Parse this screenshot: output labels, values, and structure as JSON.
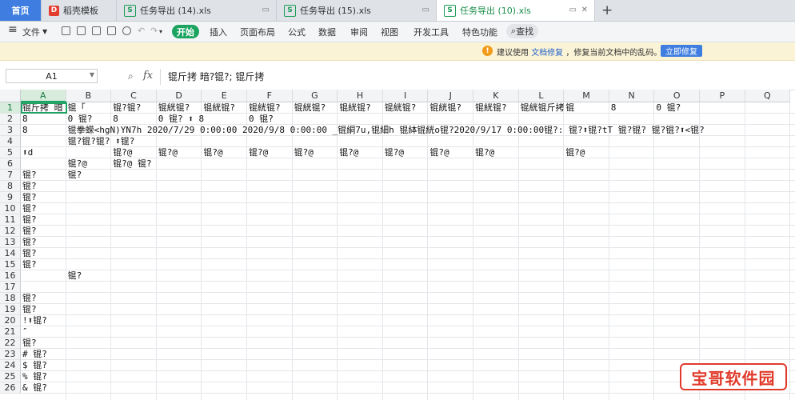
{
  "tabs": {
    "home": "首页",
    "items": [
      {
        "label": "稻壳模板",
        "icon": "D",
        "color": "#e23d2f"
      },
      {
        "label": "任务导出 (14).xls",
        "icon": "S",
        "color": "#1a9c55"
      },
      {
        "label": "任务导出 (15).xls",
        "icon": "S",
        "color": "#1a9c55"
      },
      {
        "label": "任务导出 (10).xls",
        "icon": "S",
        "color": "#1a9c55"
      }
    ],
    "plus": "+"
  },
  "menu": {
    "hamburger": "≡",
    "file": "文件",
    "start": "开始",
    "items": [
      "插入",
      "页面布局",
      "公式",
      "数据",
      "审阅",
      "视图",
      "开发工具",
      "特色功能"
    ],
    "search": "查找"
  },
  "notice": {
    "text_before": "建议使用",
    "link": "文档修复",
    "text_after": "，修复当前文档中的乱码。",
    "button": "立即修复"
  },
  "formula": {
    "cell_ref": "A1",
    "fx": "fx",
    "value": "锟斤拷  暗?锟?;  锟斤拷"
  },
  "grid": {
    "columns": [
      "A",
      "B",
      "C",
      "D",
      "E",
      "F",
      "G",
      "H",
      "I",
      "J",
      "K",
      "L",
      "M",
      "N",
      "O",
      "P",
      "Q"
    ],
    "rows": [
      "1",
      "2",
      "3",
      "4",
      "5",
      "6",
      "7",
      "8",
      "9",
      "10",
      "11",
      "12",
      "13",
      "14",
      "15",
      "16",
      "17",
      "18",
      "19",
      "20",
      "21",
      "22",
      "23",
      "24",
      "25",
      "26"
    ],
    "selected_col": "A",
    "selected_row": "1"
  },
  "cells": [
    {
      "r": 1,
      "c": 0,
      "t": "锟斤拷  暗"
    },
    {
      "r": 1,
      "c": 1,
      "t": "        锟「"
    },
    {
      "r": 1,
      "c": 2,
      "t": " 锟?锟? "
    },
    {
      "r": 1,
      "c": 3,
      "t": " 锟絖锟?"
    },
    {
      "r": 1,
      "c": 4,
      "t": " 锟絖锟?"
    },
    {
      "r": 1,
      "c": 5,
      "t": " 锟絖锟?"
    },
    {
      "r": 1,
      "c": 6,
      "t": " 锟絖锟?"
    },
    {
      "r": 1,
      "c": 7,
      "t": " 锟絖锟?"
    },
    {
      "r": 1,
      "c": 8,
      "t": " 锟絖锟?"
    },
    {
      "r": 1,
      "c": 9,
      "t": " 锟絖锟?"
    },
    {
      "r": 1,
      "c": 10,
      "t": " 锟絖锟?"
    },
    {
      "r": 1,
      "c": 11,
      "t": " 锟絖锟斤拷"
    },
    {
      "r": 1,
      "c": 12,
      "t": "  锟"
    },
    {
      "r": 1,
      "c": 13,
      "t": "    8"
    },
    {
      "r": 1,
      "c": 14,
      "t": "     0 锟?"
    },
    {
      "r": 2,
      "c": 0,
      "t": "  8"
    },
    {
      "r": 2,
      "c": 1,
      "t": "    0 锟?"
    },
    {
      "r": 2,
      "c": 2,
      "t": "  8"
    },
    {
      "r": 2,
      "c": 3,
      "t": "  0 锟? ⬆ 8"
    },
    {
      "r": 2,
      "c": 5,
      "t": "  0 锟?"
    },
    {
      "r": 3,
      "c": 0,
      "t": "  8"
    },
    {
      "r": 3,
      "c": 1,
      "t": "  锟拳蝾<hgN)YN7h 2020/7/29 0:00:00 2020/9/8 0:00:00   _锟絧7u,锟細h  锟絊锟絖o锟?2020/9/17 0:00:00锟?: 锟?⬆锟?tT 锟?锟?    锟?锟?⬆<锟?"
    },
    {
      "r": 4,
      "c": 1,
      "t": "      锟?锟?锟?  ⬆锟?"
    },
    {
      "r": 5,
      "c": 0,
      "t": "  ⬆d"
    },
    {
      "r": 5,
      "c": 2,
      "t": " 锟?@"
    },
    {
      "r": 5,
      "c": 3,
      "t": " 锟?@"
    },
    {
      "r": 5,
      "c": 4,
      "t": " 锟?@"
    },
    {
      "r": 5,
      "c": 5,
      "t": " 锟?@"
    },
    {
      "r": 5,
      "c": 6,
      "t": " 锟?@"
    },
    {
      "r": 5,
      "c": 7,
      "t": " 锟?@"
    },
    {
      "r": 5,
      "c": 8,
      "t": " 锟?@"
    },
    {
      "r": 5,
      "c": 9,
      "t": " 锟?@"
    },
    {
      "r": 5,
      "c": 10,
      "t": " 锟?@"
    },
    {
      "r": 5,
      "c": 12,
      "t": " 锟?@"
    },
    {
      "r": 6,
      "c": 1,
      "t": " 锟?@"
    },
    {
      "r": 6,
      "c": 2,
      "t": " 锟?@  锟?"
    },
    {
      "r": 7,
      "c": 0,
      "t": " 锟?"
    },
    {
      "r": 7,
      "c": 1,
      "t": "       锟?"
    },
    {
      "r": 8,
      "c": 0,
      "t": "   锟?"
    },
    {
      "r": 9,
      "c": 0,
      "t": "    锟?"
    },
    {
      "r": 10,
      "c": 0,
      "t": "    锟?"
    },
    {
      "r": 11,
      "c": 0,
      "t": "    锟?"
    },
    {
      "r": 12,
      "c": 0,
      "t": "    锟?"
    },
    {
      "r": 13,
      "c": 0,
      "t": "    锟?"
    },
    {
      "r": 14,
      "c": 0,
      "t": "   锟?"
    },
    {
      "r": 15,
      "c": 0,
      "t": "   锟?"
    },
    {
      "r": 16,
      "c": 1,
      "t": " 锟?"
    },
    {
      "r": 18,
      "c": 0,
      "t": "锟?"
    },
    {
      "r": 19,
      "c": 0,
      "t": "   锟?"
    },
    {
      "r": 20,
      "c": 0,
      "t": "   !⬆锟?"
    },
    {
      "r": 21,
      "c": 0,
      "t": "   ″"
    },
    {
      "r": 22,
      "c": 0,
      "t": "锟?"
    },
    {
      "r": 23,
      "c": 0,
      "t": "    # 锟?"
    },
    {
      "r": 24,
      "c": 0,
      "t": "    $ 锟?"
    },
    {
      "r": 25,
      "c": 0,
      "t": "    % 锟?"
    },
    {
      "r": 26,
      "c": 0,
      "t": "    & 锟?"
    }
  ],
  "watermark": {
    "text": "宝哥软件园",
    "small": "http://..."
  }
}
